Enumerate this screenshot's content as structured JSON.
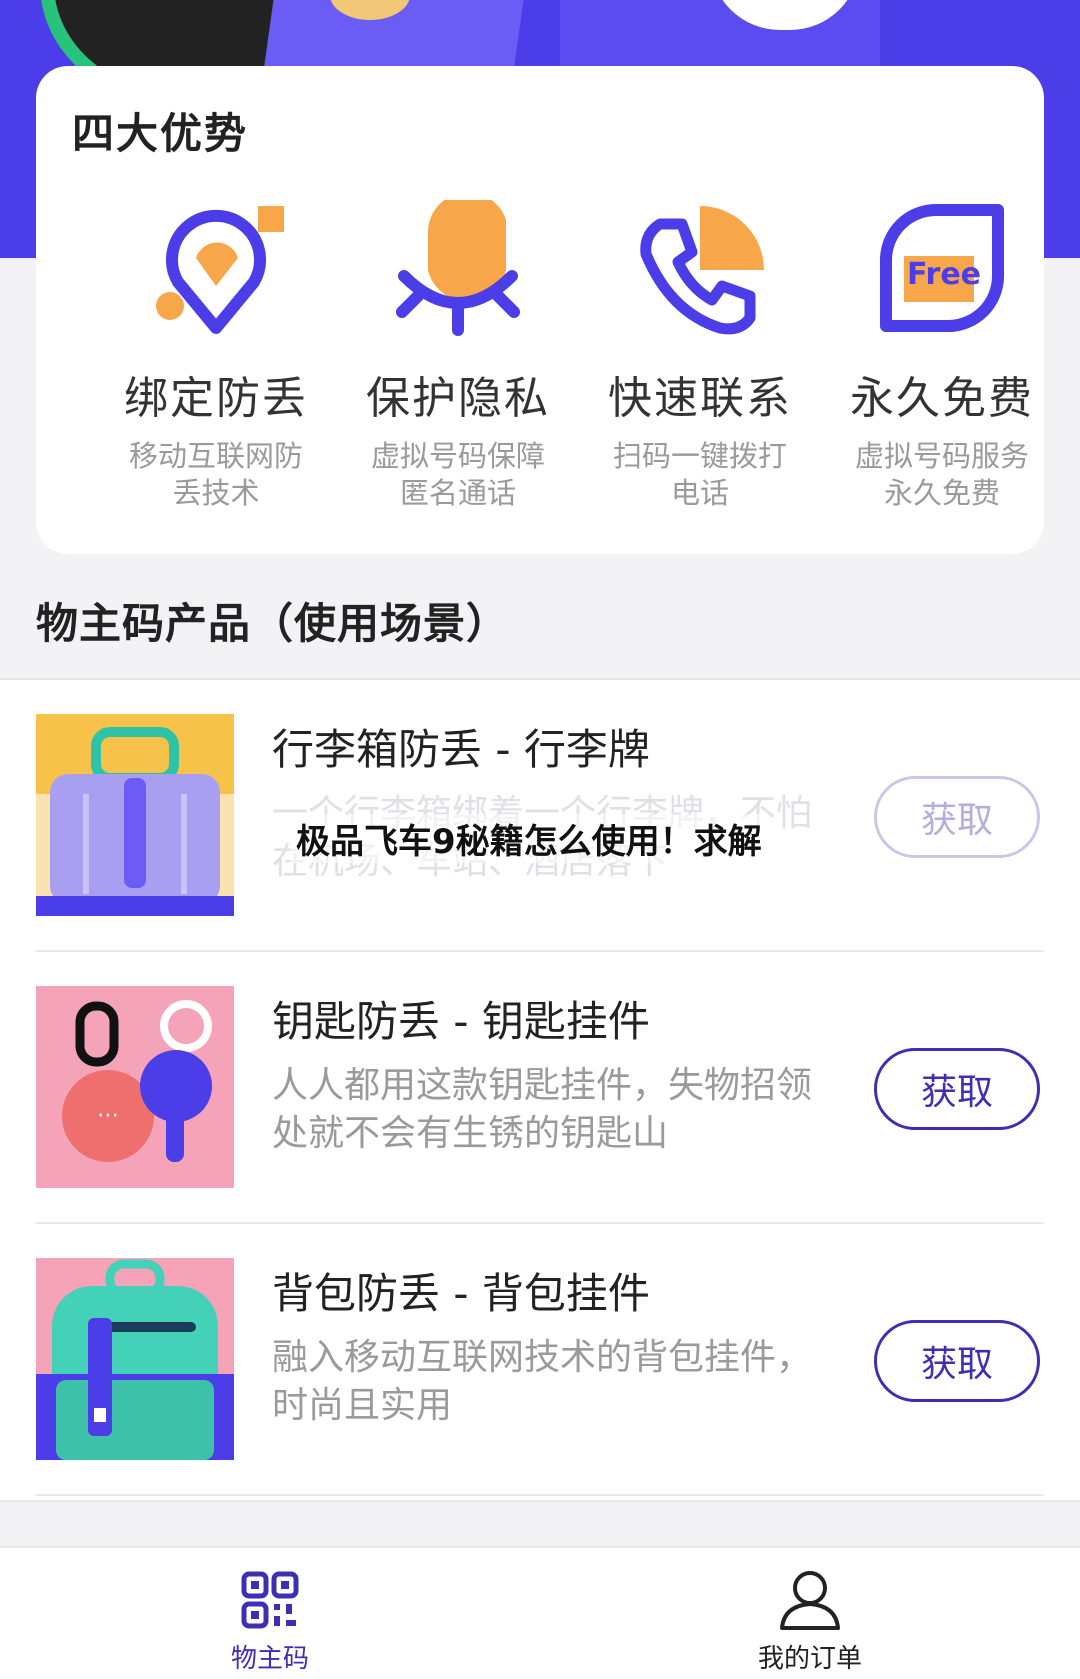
{
  "advantages": {
    "title": "四大优势",
    "items": [
      {
        "icon": "location-pin-icon",
        "name": "绑定防丢",
        "desc": "移动互联网防丢技术"
      },
      {
        "icon": "closed-eye-icon",
        "name": "保护隐私",
        "desc": "虚拟号码保障匿名通话"
      },
      {
        "icon": "phone-icon",
        "name": "快速联系",
        "desc": "扫码一键拨打电话"
      },
      {
        "icon": "free-badge-icon",
        "name": "永久免费",
        "desc": "虚拟号码服务永久免费"
      }
    ],
    "free_badge_text": "Free"
  },
  "section_title": "物主码产品（使用场景）",
  "products": [
    {
      "title": "行李箱防丢 - 行李牌",
      "desc": "一个行李箱绑着一个行李牌，不怕在机场、车站、酒店落下",
      "button": "获取"
    },
    {
      "title": "钥匙防丢 - 钥匙挂件",
      "desc": "人人都用这款钥匙挂件，失物招领处就不会有生锈的钥匙山",
      "button": "获取"
    },
    {
      "title": "背包防丢 - 背包挂件",
      "desc": "融入移动互联网技术的背包挂件，时尚且实用",
      "button": "获取"
    }
  ],
  "overlay_caption": "极品飞车9秘籍怎么使用！求解",
  "tabbar": {
    "tabs": [
      {
        "icon": "qr-code-icon",
        "label": "物主码"
      },
      {
        "icon": "user-icon",
        "label": "我的订单"
      }
    ]
  },
  "colors": {
    "brand": "#3c2fb3",
    "accent": "#4b3de8",
    "orange": "#f7a64a"
  }
}
